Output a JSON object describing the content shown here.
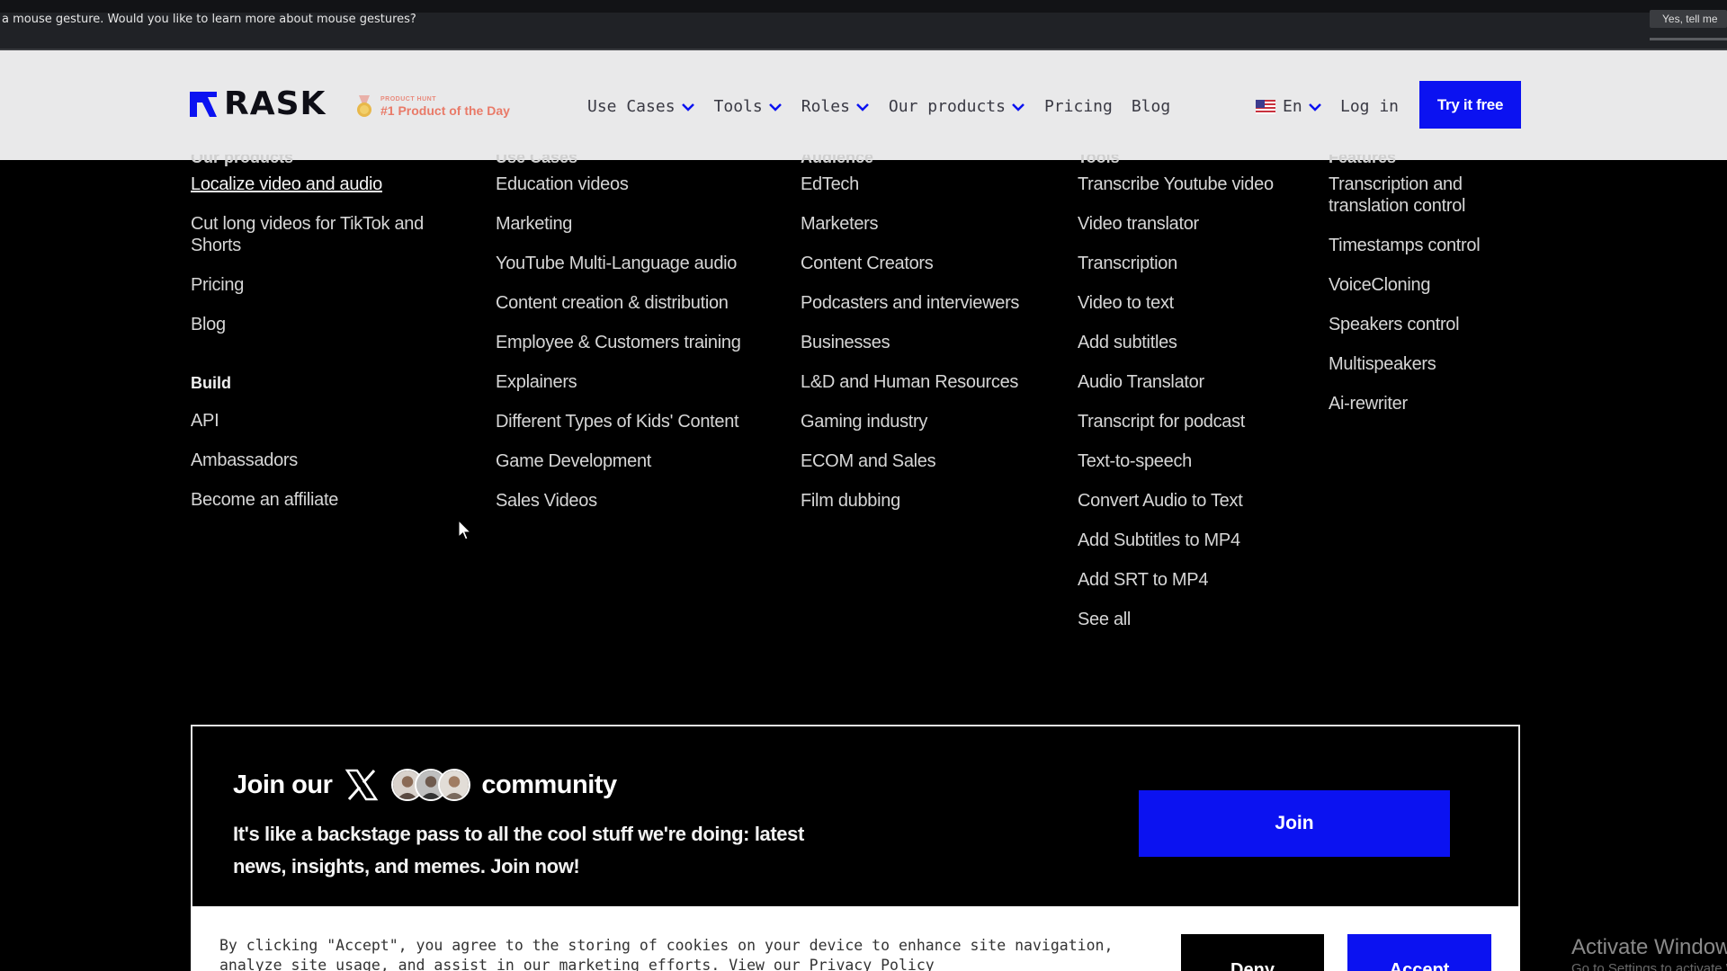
{
  "notification": {
    "text": "a mouse gesture. Would you like to learn more about mouse gestures?",
    "button": "Yes, tell me"
  },
  "header": {
    "logo": "RASK",
    "award_small": "PRODUCT HUNT",
    "award_big": "#1 Product of the Day",
    "nav": [
      "Use Cases",
      "Tools",
      "Roles",
      "Our products",
      "Pricing",
      "Blog"
    ],
    "lang": "En",
    "login": "Log in",
    "cta": "Try it free"
  },
  "columns": [
    {
      "heading": "Our products",
      "links": [
        "Localize video and audio",
        "Cut long videos for TikTok and Shorts",
        "Pricing",
        "Blog"
      ],
      "sub_heading": "Build",
      "sub_links": [
        "API",
        "Ambassadors",
        "Become an affiliate"
      ]
    },
    {
      "heading": "Use Cases",
      "links": [
        "Education videos",
        "Marketing",
        "YouTube Multi-Language audio",
        "Content creation & distribution",
        "Employee & Customers training",
        "Explainers",
        "Different Types of Kids' Content",
        "Game Development",
        "Sales Videos"
      ]
    },
    {
      "heading": "Audience",
      "links": [
        "EdTech",
        "Marketers",
        "Content Creators",
        "Podcasters and interviewers",
        "Businesses",
        "L&D and Human Resources",
        "Gaming industry",
        "ECOM and Sales",
        "Film dubbing"
      ]
    },
    {
      "heading": "Tools",
      "links": [
        "Transcribe Youtube video",
        "Video translator",
        "Transcription",
        "Video to text",
        "Add subtitles",
        "Audio Translator",
        "Transcript for podcast",
        "Text-to-speech",
        "Convert Audio to Text",
        "Add Subtitles to MP4",
        "Add SRT to MP4",
        "See all"
      ]
    },
    {
      "heading": "Features",
      "links": [
        "Transcription and translation control",
        "Timestamps control",
        "VoiceCloning",
        "Speakers control",
        "Multispeakers",
        "Ai-rewriter"
      ]
    }
  ],
  "community": {
    "title_prefix": "Join our",
    "title_suffix": "community",
    "subtitle": "It's like a backstage pass to all the cool stuff we're doing: latest news, insights, and memes. Join now!",
    "button": "Join"
  },
  "cookie": {
    "text": "By clicking \"Accept\", you agree to the storing of cookies on your device to enhance site navigation, analyze site usage, and assist in our marketing efforts. View our",
    "privacy_link": "Privacy Policy",
    "deny": "Deny",
    "accept": "Accept"
  },
  "watermark": {
    "title": "Activate Windows",
    "subtitle": "Go to Settings to activate Windows."
  },
  "colors": {
    "brand_blue": "#0b12f1",
    "header_bg": "#e9e9ea",
    "page_bg": "#000000",
    "award": "#e97a68"
  }
}
